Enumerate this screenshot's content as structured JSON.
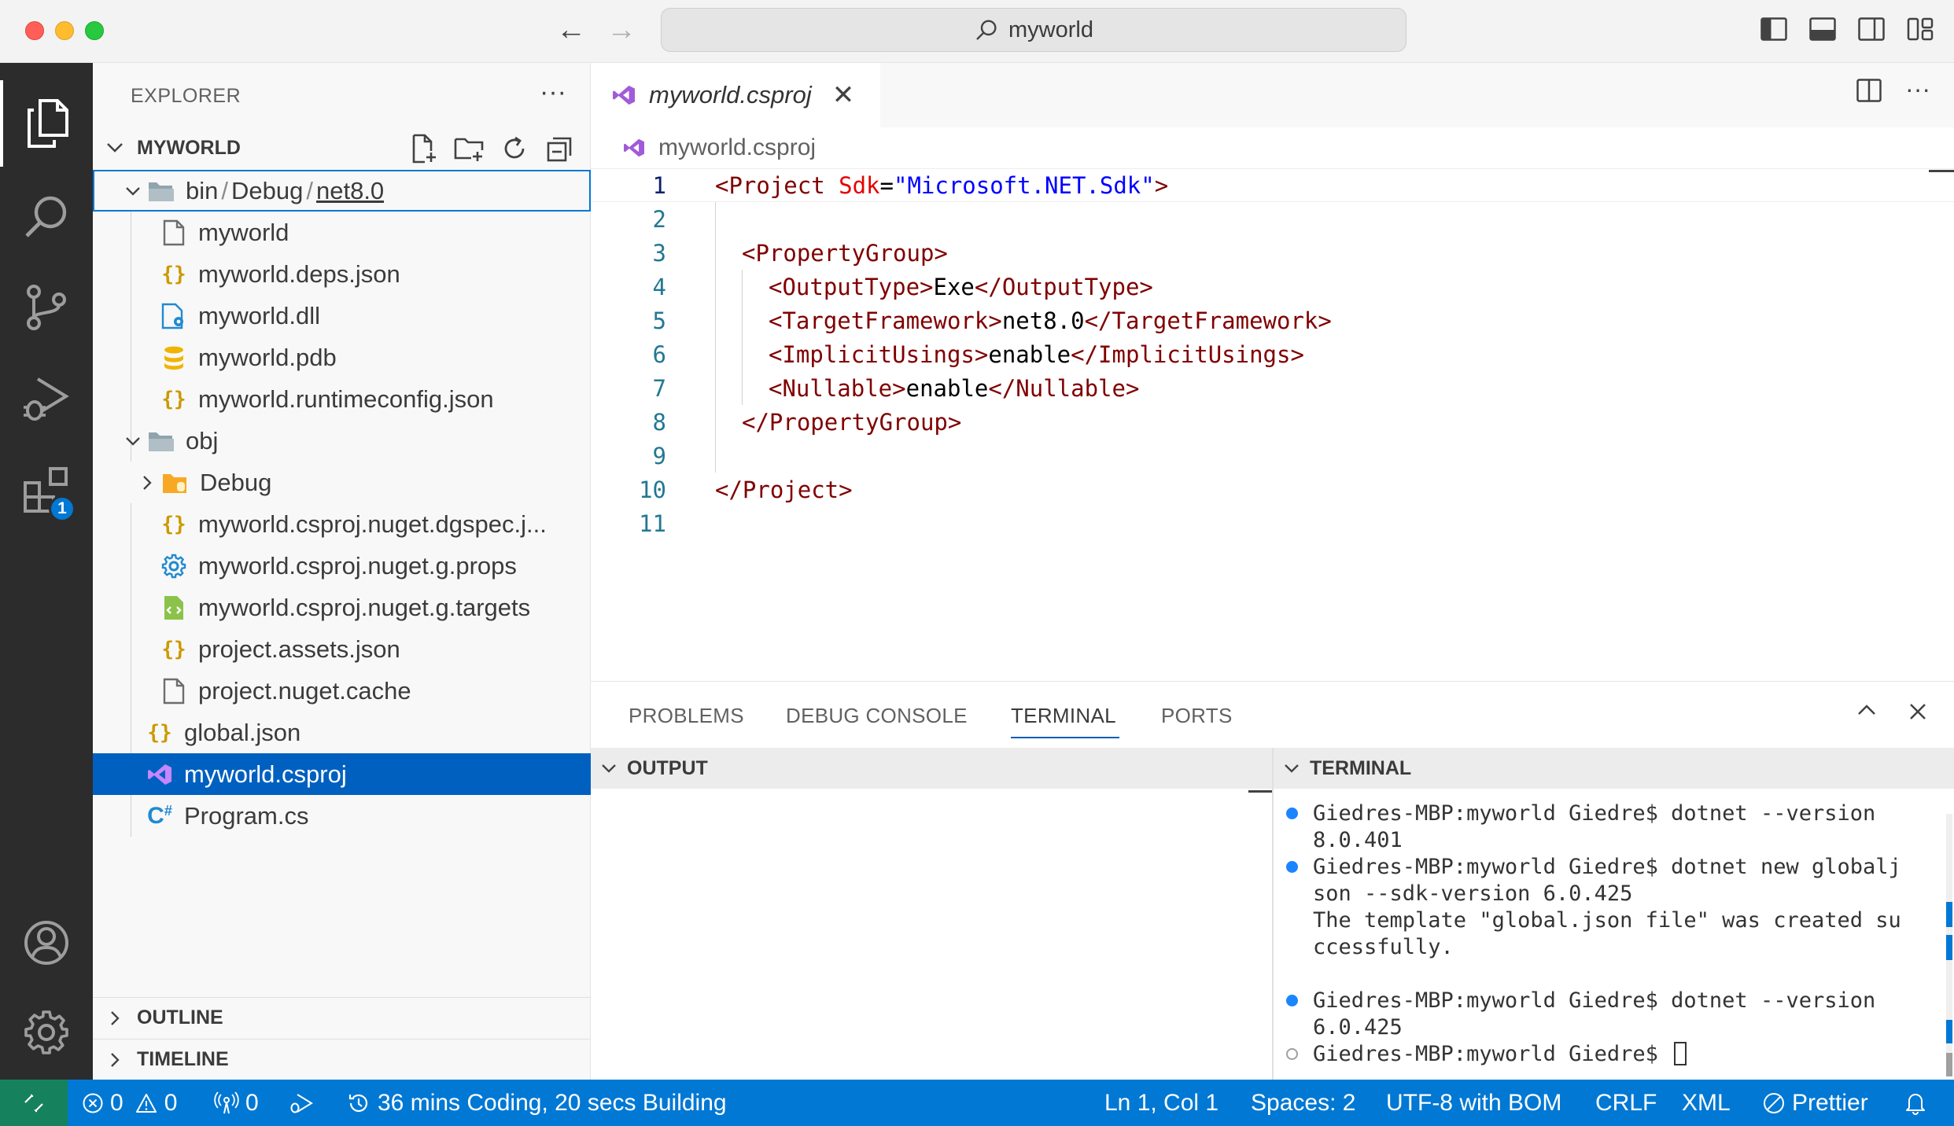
{
  "titlebar": {
    "search_text": "myworld",
    "back_icon": "arrow-left-icon",
    "forward_icon": "arrow-right-icon"
  },
  "activity_bar": {
    "extensions_badge": "1"
  },
  "sidebar": {
    "header": "EXPLORER",
    "more": "···",
    "root": "MYWORLD",
    "tree": [
      {
        "label_parts": [
          "bin",
          "Debug",
          "net8.0"
        ],
        "type": "folder-open"
      },
      {
        "label": "myworld",
        "type": "file"
      },
      {
        "label": "myworld.deps.json",
        "type": "json"
      },
      {
        "label": "myworld.dll",
        "type": "dll"
      },
      {
        "label": "myworld.pdb",
        "type": "pdb"
      },
      {
        "label": "myworld.runtimeconfig.json",
        "type": "json"
      },
      {
        "label": "obj",
        "type": "folder-open"
      },
      {
        "label": "Debug",
        "type": "folder-closed"
      },
      {
        "label": "myworld.csproj.nuget.dgspec.j...",
        "type": "json"
      },
      {
        "label": "myworld.csproj.nuget.g.props",
        "type": "props"
      },
      {
        "label": "myworld.csproj.nuget.g.targets",
        "type": "targets"
      },
      {
        "label": "project.assets.json",
        "type": "json"
      },
      {
        "label": "project.nuget.cache",
        "type": "file"
      },
      {
        "label": "global.json",
        "type": "json"
      },
      {
        "label": "myworld.csproj",
        "type": "csproj"
      },
      {
        "label": "Program.cs",
        "type": "csharp"
      }
    ],
    "outline": "OUTLINE",
    "timeline": "TIMELINE"
  },
  "editor": {
    "tab_label": "myworld.csproj",
    "breadcrumb": "myworld.csproj",
    "line_numbers": [
      "1",
      "2",
      "3",
      "4",
      "5",
      "6",
      "7",
      "8",
      "9",
      "10",
      "11"
    ],
    "lines": {
      "l1": {
        "open": "<Project ",
        "attr": "Sdk",
        "eq": "=",
        "val": "\"Microsoft.NET.Sdk\"",
        "close": ">"
      },
      "l3": "<PropertyGroup>",
      "l4": {
        "open": "<OutputType>",
        "text": "Exe",
        "close": "</OutputType>"
      },
      "l5": {
        "open": "<TargetFramework>",
        "text": "net8.0",
        "close": "</TargetFramework>"
      },
      "l6": {
        "open": "<ImplicitUsings>",
        "text": "enable",
        "close": "</ImplicitUsings>"
      },
      "l7": {
        "open": "<Nullable>",
        "text": "enable",
        "close": "</Nullable>"
      },
      "l8": "</PropertyGroup>",
      "l10": "</Project>"
    }
  },
  "panel": {
    "tabs": [
      "PROBLEMS",
      "DEBUG CONSOLE",
      "TERMINAL",
      "PORTS"
    ],
    "active_tab": "TERMINAL",
    "output_header": "OUTPUT",
    "terminal_header": "TERMINAL",
    "terminal_lines": [
      {
        "dot": "blue",
        "text": "Giedres-MBP:myworld Giedre$ dotnet --version"
      },
      {
        "dot": "",
        "text": "8.0.401"
      },
      {
        "dot": "blue",
        "text": "Giedres-MBP:myworld Giedre$ dotnet new globalj"
      },
      {
        "dot": "",
        "text": "son --sdk-version 6.0.425"
      },
      {
        "dot": "",
        "text": "The template \"global.json file\" was created su"
      },
      {
        "dot": "",
        "text": "ccessfully."
      },
      {
        "dot": "",
        "text": ""
      },
      {
        "dot": "blue",
        "text": "Giedres-MBP:myworld Giedre$ dotnet --version"
      },
      {
        "dot": "",
        "text": "6.0.425"
      },
      {
        "dot": "hollow",
        "text": "Giedres-MBP:myworld Giedre$ "
      }
    ]
  },
  "statusbar": {
    "errors": "0",
    "warnings": "0",
    "ports": "0",
    "activity": "36 mins Coding, 20 secs Building",
    "position": "Ln 1, Col 1",
    "spaces": "Spaces: 2",
    "encoding": "UTF-8 with BOM",
    "eol": "CRLF",
    "language": "XML",
    "formatter": "Prettier"
  },
  "colors": {
    "accent": "#0078d4",
    "selection": "#0060c0",
    "remote": "#16825d",
    "xml_tag": "#800000",
    "xml_attr": "#e50000",
    "xml_value": "#0000ff",
    "json_icon": "#cc9900",
    "csproj_icon": "#a15bd8"
  }
}
